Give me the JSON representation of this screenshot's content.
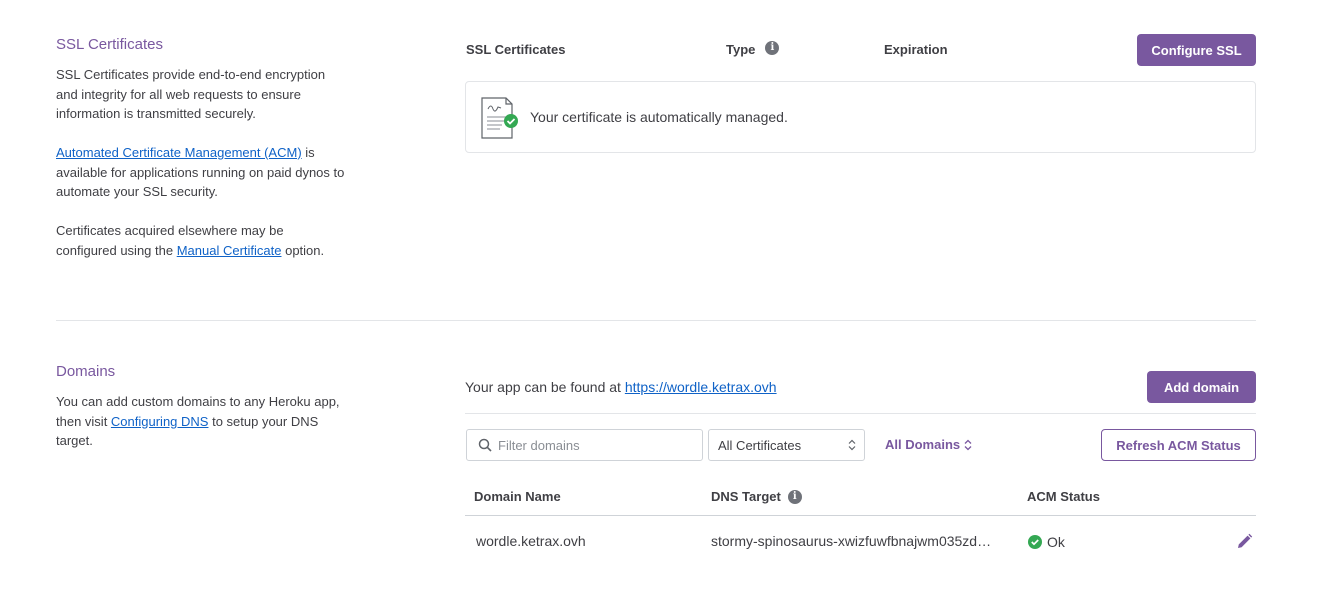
{
  "ssl": {
    "title": "SSL Certificates",
    "desc1": "SSL Certificates provide end-to-end encryption and integrity for all web requests to ensure information is transmitted securely.",
    "acm_link": "Automated Certificate Management (ACM)",
    "desc2_after": " is available for applications running on paid dynos to automate your SSL security.",
    "desc3_before": "Certificates acquired elsewhere may be configured using the ",
    "manual_link": "Manual Certificate",
    "desc3_after": " option.",
    "table": {
      "col_cert": "SSL Certificates",
      "col_type": "Type",
      "col_expiration": "Expiration"
    },
    "configure_button": "Configure SSL",
    "managed_message": "Your certificate is automatically managed."
  },
  "domains": {
    "title": "Domains",
    "desc_before": "You can add custom domains to any Heroku app, then visit ",
    "dns_link": "Configuring DNS",
    "desc_after": " to setup your DNS target.",
    "app_found_text": "Your app can be found at ",
    "app_url": "https://wordle.ketrax.ovh",
    "add_button": "Add domain",
    "filter_placeholder": "Filter domains",
    "cert_filter": "All Certificates",
    "domain_filter": "All Domains",
    "refresh_button": "Refresh ACM Status",
    "columns": {
      "domain_name": "Domain Name",
      "dns_target": "DNS Target",
      "acm_status": "ACM Status"
    },
    "rows": [
      {
        "domain": "wordle.ketrax.ovh",
        "dns_target": "stormy-spinosaurus-xwizfuwfbnajwm035zd…",
        "acm_status": "Ok"
      }
    ]
  },
  "colors": {
    "accent": "#79589f",
    "link": "#0f62c7",
    "success": "#34a853"
  }
}
